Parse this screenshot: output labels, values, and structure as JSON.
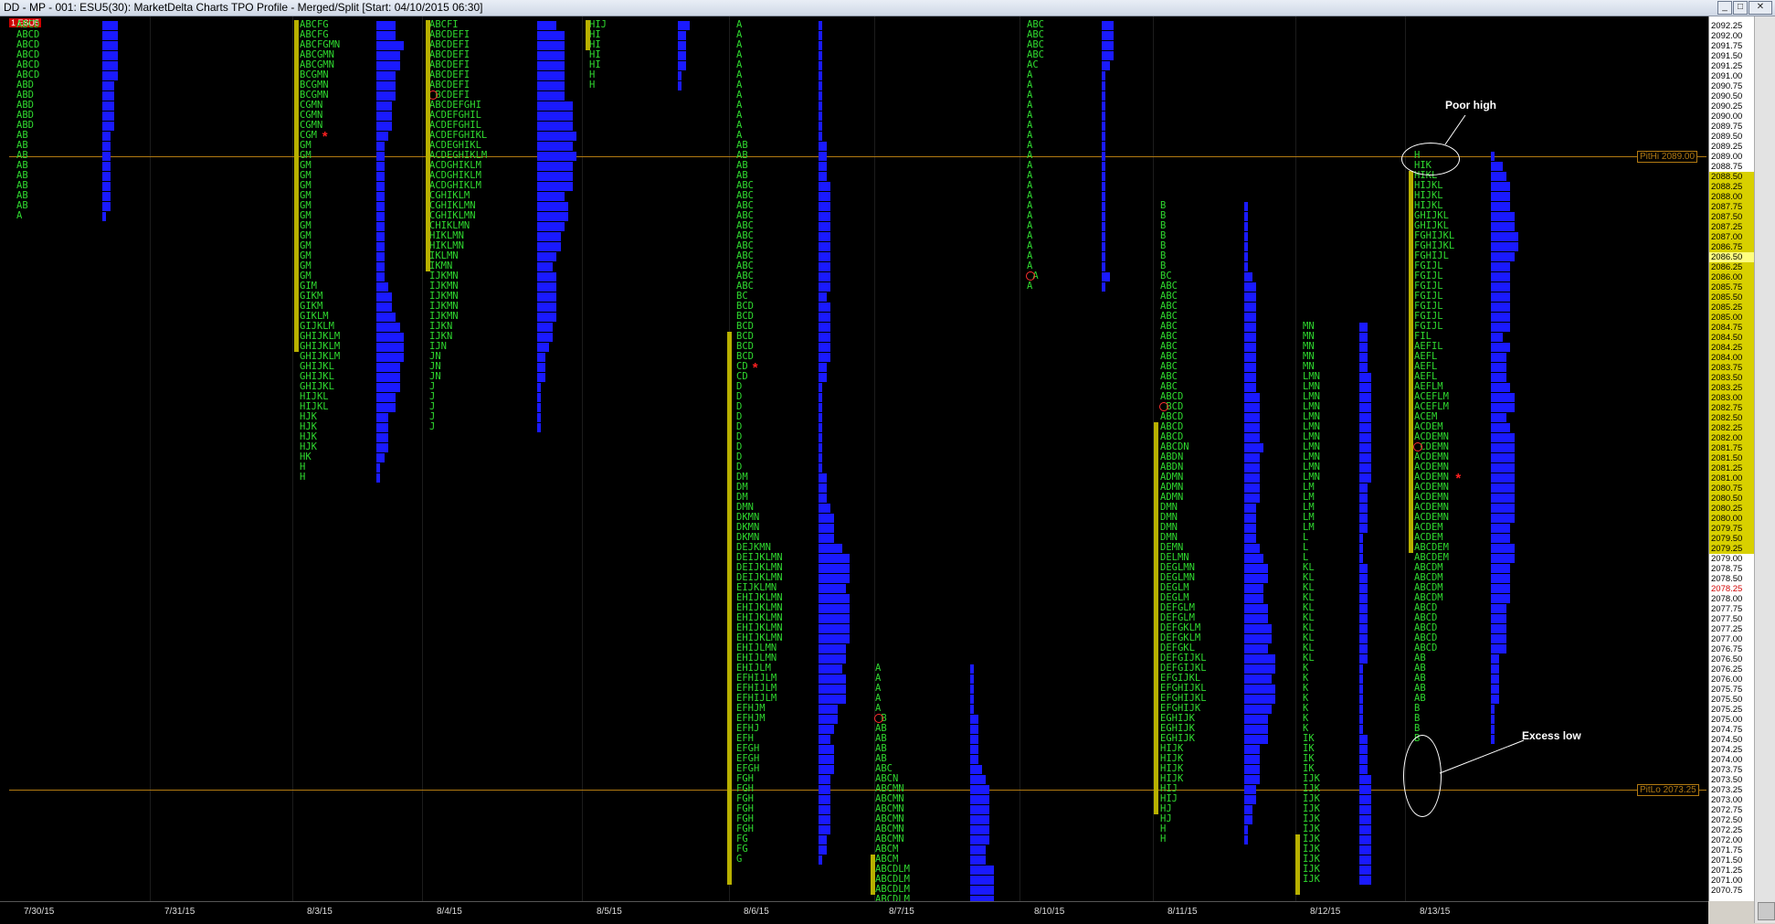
{
  "window": {
    "title": "DD - MP - 001: ESU5(30): MarketDelta Charts TPO Profile - Merged/Split [Start: 04/10/2015 06:30]",
    "symbol_badge": "ESU5",
    "pane_num": "1"
  },
  "colors": {
    "tpo_text": "#2fd92f",
    "histogram": "#1a1aff",
    "value_area": "#b8b000",
    "ref_line": "#b27a12",
    "background": "#000000",
    "annotation": "#ffffff"
  },
  "reference_lines": [
    {
      "label": "PitHi 2089.00",
      "price": 2089.0
    },
    {
      "label": "PitLo 2073.25",
      "price": 2073.25
    }
  ],
  "highlight_prices": [
    "2086.50",
    "2078.25"
  ],
  "annotations": [
    "Poor high",
    "Excess low"
  ],
  "dates": [
    "7/30/15",
    "7/31/15",
    "8/3/15",
    "8/4/15",
    "8/5/15",
    "8/6/15",
    "8/7/15",
    "8/10/15",
    "8/11/15",
    "8/12/15",
    "8/13/15"
  ],
  "price_scale": {
    "max": 2092.25,
    "min": 2070.75,
    "step": 0.25,
    "value_area_top": 2088.5,
    "value_area_bottom": 2079.25
  },
  "profiles": [
    {
      "top": 2092.25,
      "rows": [
        "ABCD",
        "ABCD",
        "ABCD",
        "ABCD",
        "ABCD",
        "ABCD",
        "ABD",
        "ABD",
        "ABD",
        "ABD",
        "ABD",
        "AB",
        "AB",
        "AB",
        "AB",
        "AB",
        "AB",
        "AB",
        "AB",
        "A"
      ],
      "va_top": null,
      "va_bottom": null,
      "poc": null,
      "open": null
    },
    {
      "top": 2092.25,
      "rows": [
        "ABCFG",
        "ABCFG",
        "ABCFGMN",
        "ABCGMN",
        "ABCGMN",
        "BCGMN",
        "BCGMN",
        "BCGMN",
        "CGMN",
        "CGMN",
        "CGMN",
        "CGM",
        "GM",
        "GM",
        "GM",
        "GM",
        "GM",
        "GM",
        "GM",
        "GM",
        "GM",
        "GM",
        "GM",
        "GM",
        "GM",
        "GM",
        "GIM",
        "GIKM",
        "GIKM",
        "GIKLM",
        "GIJKLM",
        "GHIJKLM",
        "GHIJKLM",
        "GHIJKLM",
        "GHIJKL",
        "GHIJKL",
        "GHIJKL",
        "HIJKL",
        "HIJKL",
        "HJK",
        "HJK",
        "HJK",
        "HJK",
        "HK",
        "H",
        "H"
      ],
      "va_top": 2092.25,
      "va_bottom": 2084.25,
      "poc": 2089.5,
      "open": null
    },
    {
      "top": 2092.25,
      "rows": [
        "ABCFI",
        "ABCDEFI",
        "ABCDEFI",
        "ABCDEFI",
        "ABCDEFI",
        "ABCDEFI",
        "ABCDEFI",
        "OBCDEFI",
        "ABCDEFGHI",
        "ACDEFGHIL",
        "ACDEFGHIL",
        "ACDEFGHIKL",
        "ACDEGHIKL",
        "ACDEGHIKLM",
        "ACDGHIKLM",
        "ACDGHIKLM",
        "ACDGHIKLM",
        "CGHIKLM",
        "CGHIKLMN",
        "CGHIKLMN",
        "CHIKLMN",
        "HIKLMN",
        "HIKLMN",
        "IKLMN",
        "IKMN",
        "IJKMN",
        "IJKMN",
        "IJKMN",
        "IJKMN",
        "IJKMN",
        "IJKN",
        "IJKN",
        "IJN",
        "JN",
        "JN",
        "JN",
        "J",
        "J",
        "J",
        "J",
        "J"
      ],
      "va_top": 2092.25,
      "va_bottom": 2086.25,
      "poc": null,
      "open": null
    },
    {
      "top": 2092.25,
      "rows": [
        "HIJ",
        "HI",
        "HI",
        "HI",
        "HI",
        "H",
        "H"
      ],
      "va_top": 2092.25,
      "va_bottom": 2091.75,
      "poc": null,
      "open": null
    },
    {
      "top": 2092.25,
      "rows": [
        "A",
        "A",
        "A",
        "A",
        "A",
        "A",
        "A",
        "A",
        "A",
        "A",
        "A",
        "A",
        "AB",
        "AB",
        "AB",
        "AB",
        "ABC",
        "ABC",
        "ABC",
        "ABC",
        "ABC",
        "ABC",
        "ABC",
        "ABC",
        "ABC",
        "ABC",
        "ABC",
        "BC",
        "BCD",
        "BCD",
        "BCD",
        "BCD",
        "BCD",
        "BCD",
        "CD",
        "CD",
        "D",
        "D",
        "D",
        "D",
        "D",
        "D",
        "D",
        "D",
        "D",
        "DM",
        "DM",
        "DM",
        "DMN",
        "DKMN",
        "DKMN",
        "DKMN",
        "DEJKMN",
        "DEIJKLMN",
        "DEIJKLMN",
        "DEIJKLMN",
        "EIJKLMN",
        "EHIJKLMN",
        "EHIJKLMN",
        "EHIJKLMN",
        "EHIJKLMN",
        "EHIJKLMN",
        "EHIJLMN",
        "EHIJLMN",
        "EHIJLM",
        "EFHIJLM",
        "EFHIJLM",
        "EFHIJLM",
        "EFHJM",
        "EFHJM",
        "EFHJ",
        "EFH",
        "EFGH",
        "EFGH",
        "EFGH",
        "FGH",
        "FGH",
        "FGH",
        "FGH",
        "FGH",
        "FGH",
        "FG",
        "FG",
        "G"
      ],
      "va_top": 2084.5,
      "va_bottom": 2071.0,
      "poc": 2083.75,
      "open": null
    },
    {
      "top": 2076.25,
      "rows": [
        "A",
        "A",
        "A",
        "A",
        "A",
        "OB",
        "AB",
        "AB",
        "AB",
        "AB",
        "ABC",
        "ABCN",
        "ABCMN",
        "ABCMN",
        "ABCMN",
        "ABCMN",
        "ABCMN",
        "ABCMN",
        "ABCM",
        "ABCM",
        "ABCDLM",
        "ABCDLM",
        "ABCDLM",
        "ABCDLM"
      ],
      "va_top": 2071.5,
      "va_bottom": 2070.75,
      "poc": null,
      "open": null
    },
    {
      "top": 2092.25,
      "rows": [
        "ABC",
        "ABC",
        "ABC",
        "ABC",
        "AC",
        "A",
        "A",
        "A",
        "A",
        "A",
        "A",
        "A",
        "A",
        "A",
        "A",
        "A",
        "A",
        "A",
        "A",
        "A",
        "A",
        "A",
        "A",
        "A",
        "A",
        "OA",
        "A"
      ],
      "va_top": null,
      "va_bottom": null,
      "poc": null,
      "open": null
    },
    {
      "top": 2087.75,
      "rows": [
        "B",
        "B",
        "B",
        "B",
        "B",
        "B",
        "B",
        "BC",
        "ABC",
        "ABC",
        "ABC",
        "ABC",
        "ABC",
        "ABC",
        "ABC",
        "ABC",
        "ABC",
        "ABC",
        "ABC",
        "ABCD",
        "OBCD",
        "ABCD",
        "ABCD",
        "ABCD",
        "ABCDN",
        "ABDN",
        "ABDN",
        "ADMN",
        "ADMN",
        "ADMN",
        "DMN",
        "DMN",
        "DMN",
        "DMN",
        "DEMN",
        "DELMN",
        "DEGLMN",
        "DEGLMN",
        "DEGLM",
        "DEGLM",
        "DEFGLM",
        "DEFGLM",
        "DEFGKLM",
        "DEFGKLM",
        "DEFGKL",
        "DEFGIJKL",
        "DEFGIJKL",
        "EFGIJKL",
        "EFGHIJKL",
        "EFGHIJKL",
        "EFGHIJK",
        "EGHIJK",
        "EGHIJK",
        "EGHIJK",
        "HIJK",
        "HIJK",
        "HIJK",
        "HIJK",
        "HIJ",
        "HIJ",
        "HJ",
        "HJ",
        "H",
        "H"
      ],
      "va_top": 2082.25,
      "va_bottom": 2072.75,
      "poc": null,
      "open": null
    },
    {
      "top": 2084.75,
      "rows": [
        "MN",
        "MN",
        "MN",
        "MN",
        "MN",
        "LMN",
        "LMN",
        "LMN",
        "LMN",
        "LMN",
        "LMN",
        "LMN",
        "LMN",
        "LMN",
        "LMN",
        "LMN",
        "LM",
        "LM",
        "LM",
        "LM",
        "LM",
        "L",
        "L",
        "L",
        "KL",
        "KL",
        "KL",
        "KL",
        "KL",
        "KL",
        "KL",
        "KL",
        "KL",
        "KL",
        "K",
        "K",
        "K",
        "K",
        "K",
        "K",
        "K",
        "IK",
        "IK",
        "IK",
        "IK",
        "IJK",
        "IJK",
        "IJK",
        "IJK",
        "IJK",
        "IJK",
        "IJK",
        "IJK",
        "IJK",
        "IJK",
        "IJK"
      ],
      "va_top": 2072.0,
      "va_bottom": 2070.75,
      "poc": null,
      "open": null
    },
    {
      "top": 2089.0,
      "rows": [
        "H",
        "HIK",
        "HIKL",
        "HIJKL",
        "HIJKL",
        "HIJKL",
        "GHIJKL",
        "GHIJKL",
        "FGHIJKL",
        "FGHIJKL",
        "FGHIJL",
        "FGIJL",
        "FGIJL",
        "FGIJL",
        "FGIJL",
        "FGIJL",
        "FGIJL",
        "FGIJL",
        "FIL",
        "AEFIL",
        "AEFL",
        "AEFL",
        "AEFL",
        "AEFLM",
        "ACEFLM",
        "ACEFLM",
        "ACEM",
        "ACDEM",
        "ACDEMN",
        "OCDEMN",
        "ACDEMN",
        "ACDEMN",
        "ACDEMN",
        "ACDEMN",
        "ACDEMN",
        "ACDEMN",
        "ACDEMN",
        "ACDEM",
        "ACDEM",
        "ABCDEM",
        "ABCDEM",
        "ABCDM",
        "ABCDM",
        "ABCDM",
        "ABCDM",
        "ABCD",
        "ABCD",
        "ABCD",
        "ABCD",
        "ABCD",
        "AB",
        "AB",
        "AB",
        "AB",
        "AB",
        "B",
        "B",
        "B",
        "B"
      ],
      "va_top": 2088.5,
      "va_bottom": 2079.25,
      "poc": 2081.0,
      "open": null
    }
  ]
}
